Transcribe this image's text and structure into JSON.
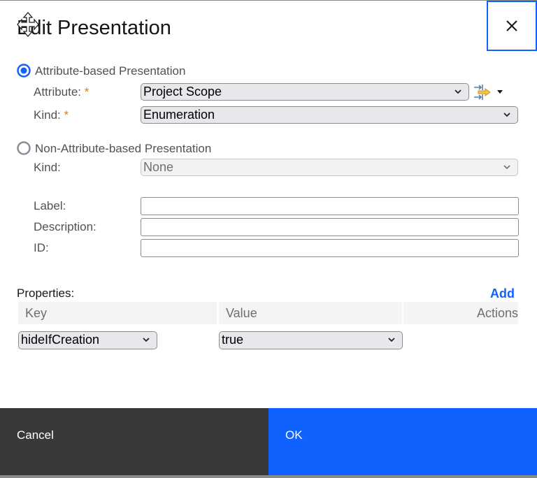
{
  "dialog": {
    "title": "Edit Presentation",
    "close_label": "Close"
  },
  "attribute_based": {
    "label": "Attribute-based Presentation",
    "selected": true,
    "attribute_label": "Attribute:",
    "attribute_value": "Project Scope",
    "kind_label": "Kind:",
    "kind_value": "Enumeration",
    "required_mark": "*"
  },
  "non_attribute_based": {
    "label": "Non-Attribute-based Presentation",
    "selected": false,
    "kind_label": "Kind:",
    "kind_value": "None"
  },
  "fields": {
    "label_label": "Label:",
    "label_value": "",
    "description_label": "Description:",
    "description_value": "",
    "id_label": "ID:",
    "id_value": ""
  },
  "properties": {
    "label": "Properties:",
    "add_label": "Add",
    "columns": [
      "Key",
      "Value",
      "Actions"
    ],
    "rows": [
      {
        "key": "hideIfCreation",
        "value": "true"
      }
    ]
  },
  "footer": {
    "cancel_label": "Cancel",
    "ok_label": "OK"
  },
  "colors": {
    "primary": "#0f62fe",
    "secondary": "#393939",
    "required": "#e07a10"
  }
}
